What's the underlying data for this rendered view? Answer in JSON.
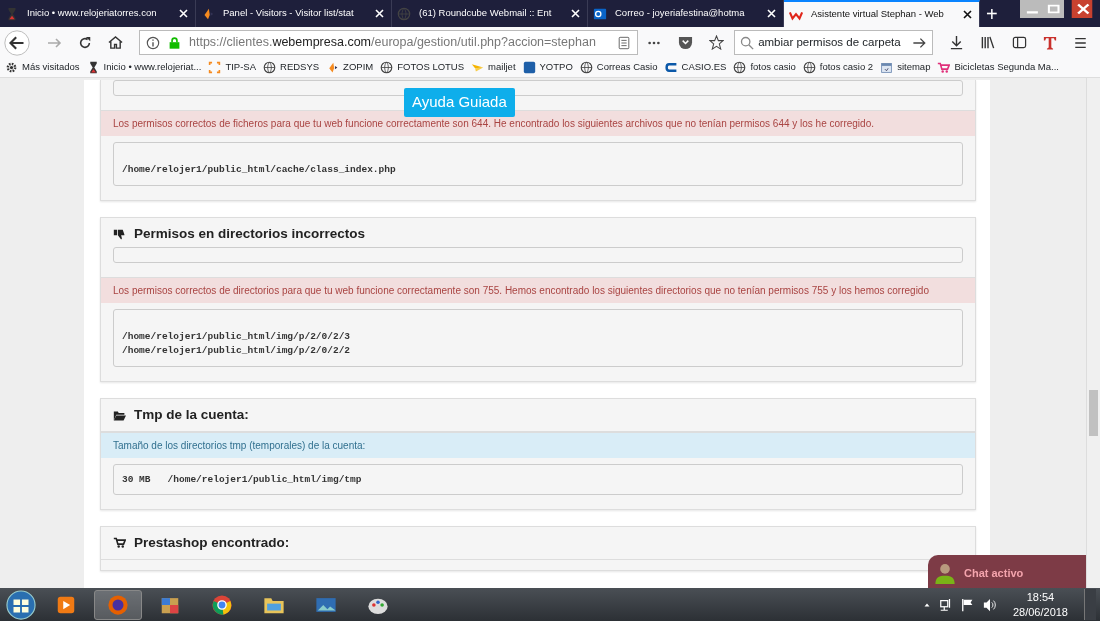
{
  "tabs": [
    {
      "title": "Inicio • www.relojeriatorres.con",
      "selected": false
    },
    {
      "title": "Panel - Visitors - Visitor list/stat",
      "selected": false
    },
    {
      "title": "(61) Roundcube Webmail :: Ent",
      "selected": false
    },
    {
      "title": "Correo - joyeriafestina@hotma",
      "selected": false
    },
    {
      "title": "Asistente virtual Stephan - Web",
      "selected": true
    }
  ],
  "new_tab": "+",
  "address": {
    "prefix": "https://clientes.",
    "domain": "webempresa.com",
    "path": "/europa/gestion/util.php?accion=stephan"
  },
  "search": {
    "value": "ambiar permisos de carpeta"
  },
  "bookmarks": [
    "Más visitados",
    "Inicio • www.relojeriat...",
    "TIP-SA",
    "REDSYS",
    "ZOPIM",
    "FOTOS LOTUS",
    "mailjet",
    "YOTPO",
    "Correas Casio",
    "CASIO.ES",
    "fotos casio",
    "fotos casio 2",
    "sitemap",
    "Bicicletas Segunda Ma..."
  ],
  "guide_button": "Ayuda Guiada",
  "sections": [
    {
      "kind": "check",
      "alert": {
        "kind": "danger",
        "text": "Los permisos correctos de ficheros para que tu web funcione correctamente son 644. He encontrado los siguientes archivos que no tenían permisos 644 y los he corregido."
      },
      "paths": [
        "/home/relojer1/public_html/cache/class_index.php"
      ]
    },
    {
      "title": "Permisos en directorios incorrectos",
      "kind": "check",
      "alert": {
        "kind": "danger",
        "text": "Los permisos correctos de directorios para que tu web funcione correctamente son 755. Hemos encontrado los siguientes directorios que no tenían permisos 755 y los hemos corregido"
      },
      "paths": [
        "/home/relojer1/public_html/img/p/2/0/2/3",
        "/home/relojer1/public_html/img/p/2/0/2/2"
      ]
    },
    {
      "title": "Tmp de la cuenta:",
      "kind": "summary",
      "alert": {
        "kind": "info",
        "text": "Tamaño de los directorios tmp (temporales) de la cuenta:"
      },
      "paths": [
        "30 MB   /home/relojer1/public_html/img/tmp"
      ]
    },
    {
      "title": "Prestashop encontrado:",
      "kind": "summary"
    }
  ],
  "chat": {
    "label": "Chat activo"
  },
  "clock": {
    "time": "18:54",
    "date": "28/06/2018"
  }
}
